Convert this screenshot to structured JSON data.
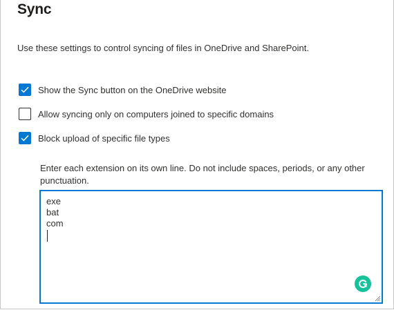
{
  "sync": {
    "title": "Sync",
    "description": "Use these settings to control syncing of files in OneDrive and SharePoint.",
    "options": [
      {
        "label": "Show the Sync button on the OneDrive website",
        "checked": true
      },
      {
        "label": "Allow syncing only on computers joined to specific domains",
        "checked": false
      },
      {
        "label": "Block upload of specific file types",
        "checked": true
      }
    ],
    "block_uploads": {
      "help_text": "Enter each extension on its own line. Do not include spaces, periods, or any other punctuation.",
      "extensions_value": "exe\nbat\ncom\n"
    }
  },
  "icons": {
    "checkmark": "checkmark-icon",
    "grammarly": "grammarly-icon",
    "resize": "resize-grip-icon"
  },
  "colors": {
    "accent": "#0078d4",
    "text": "#323130",
    "title": "#201f1e",
    "grammarly": "#15c39a"
  }
}
